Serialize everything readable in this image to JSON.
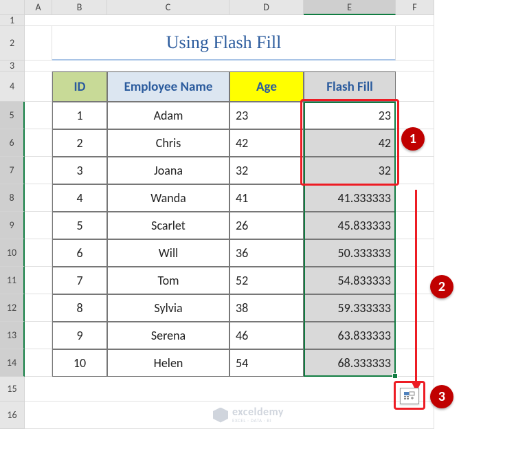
{
  "columns": [
    "A",
    "B",
    "C",
    "D",
    "E",
    "F"
  ],
  "rows": [
    "1",
    "2",
    "3",
    "4",
    "5",
    "6",
    "7",
    "8",
    "9",
    "10",
    "11",
    "12",
    "13",
    "14",
    "15",
    "16"
  ],
  "title": "Using Flash Fill",
  "headers": {
    "id": "ID",
    "name": "Employee Name",
    "age": "Age",
    "ff": "Flash Fill"
  },
  "data": [
    {
      "id": "1",
      "name": "Adam",
      "age": "23",
      "ff": "23"
    },
    {
      "id": "2",
      "name": "Chris",
      "age": "42",
      "ff": "42"
    },
    {
      "id": "3",
      "name": "Joana",
      "age": "32",
      "ff": "32"
    },
    {
      "id": "4",
      "name": "Wanda",
      "age": "41",
      "ff": "41.333333"
    },
    {
      "id": "5",
      "name": "Scarlet",
      "age": "26",
      "ff": "45.833333"
    },
    {
      "id": "6",
      "name": "Will",
      "age": "36",
      "ff": "50.333333"
    },
    {
      "id": "7",
      "name": "Tom",
      "age": "52",
      "ff": "54.833333"
    },
    {
      "id": "8",
      "name": "Sylvia",
      "age": "38",
      "ff": "59.333333"
    },
    {
      "id": "9",
      "name": "Serena",
      "age": "46",
      "ff": "63.833333"
    },
    {
      "id": "10",
      "name": "Helen",
      "age": "54",
      "ff": "68.333333"
    }
  ],
  "callouts": {
    "one": "1",
    "two": "2",
    "three": "3"
  },
  "watermark": {
    "name": "exceldemy",
    "tag": "EXCEL · DATA · BI"
  },
  "active_cell": "E5",
  "selection": "E5:E14",
  "colors": {
    "accent": "#107c41",
    "annotation": "#ed1c24",
    "callout": "#c00000"
  }
}
